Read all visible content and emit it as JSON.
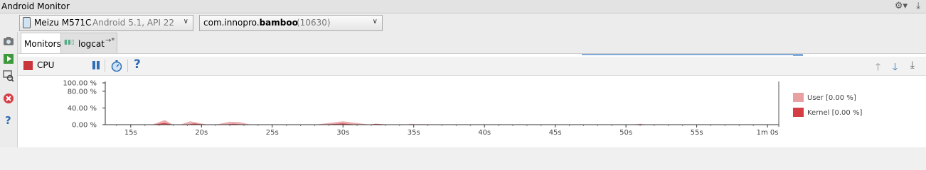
{
  "window": {
    "title": "Android Monitor"
  },
  "toolbar": {
    "device": {
      "name": "Meizu M571C",
      "meta": "Android 5.1, API 22"
    },
    "process": {
      "package_prefix": "com.innopro.",
      "package_bold": "bamboo",
      "pid": "(10630)"
    }
  },
  "tabs": [
    {
      "label": "Monitors",
      "active": true
    },
    {
      "label": "logcat",
      "active": false
    }
  ],
  "cpu": {
    "label": "CPU"
  },
  "colors": {
    "user": "#e8a0a3",
    "kernel": "#d53d45",
    "accent": "#2f6db5"
  },
  "chart_data": {
    "type": "area",
    "title": "",
    "xlabel": "",
    "ylabel": "",
    "yticks": [
      "100.00 %",
      "80.00 %",
      "40.00 %",
      "0.00 %"
    ],
    "ytick_values": [
      100,
      80,
      40,
      0
    ],
    "ylim": [
      0,
      100
    ],
    "xticks": [
      "15s",
      "20s",
      "25s",
      "30s",
      "35s",
      "40s",
      "45s",
      "50s",
      "55s",
      "1m 0s"
    ],
    "xtick_values": [
      15,
      20,
      25,
      30,
      35,
      40,
      45,
      50,
      55,
      60
    ],
    "xlim": [
      13.2,
      60.8
    ],
    "legend_position": "right",
    "series": [
      {
        "name": "User [0.00 %]",
        "x": [
          13.2,
          16.5,
          17.4,
          18.0,
          18.5,
          19.2,
          19.8,
          20.5,
          21.0,
          22.0,
          22.7,
          23.5,
          24.5,
          28.0,
          30.0,
          31.2,
          32.0,
          33.0,
          34.5,
          34.8,
          35.3,
          36.0,
          40.8,
          41.0,
          41.5,
          50.3,
          51.0,
          51.6,
          52.0,
          60.8
        ],
        "values": [
          0,
          0,
          11,
          0,
          0,
          8,
          4,
          0,
          0,
          7,
          6,
          0,
          0,
          0,
          8,
          3,
          0,
          0,
          0,
          2,
          0,
          0,
          0,
          1,
          0,
          0,
          2,
          0,
          0,
          0
        ]
      },
      {
        "name": "Kernel [0.00 %]",
        "x": [
          13.2,
          16.5,
          17.4,
          18.0,
          19.0,
          19.5,
          20.2,
          21.5,
          22.3,
          23.0,
          28.5,
          30.0,
          31.0,
          31.8,
          32.3,
          33.5,
          34.7,
          35.2,
          40.8,
          41.1,
          41.5,
          50.5,
          51.1,
          51.6,
          60.8
        ],
        "values": [
          0,
          0,
          4,
          0,
          0,
          3,
          0,
          0,
          2,
          0,
          0,
          3,
          0,
          0,
          2,
          0,
          0,
          1,
          0,
          1,
          0,
          0,
          1,
          0,
          0
        ]
      }
    ]
  }
}
